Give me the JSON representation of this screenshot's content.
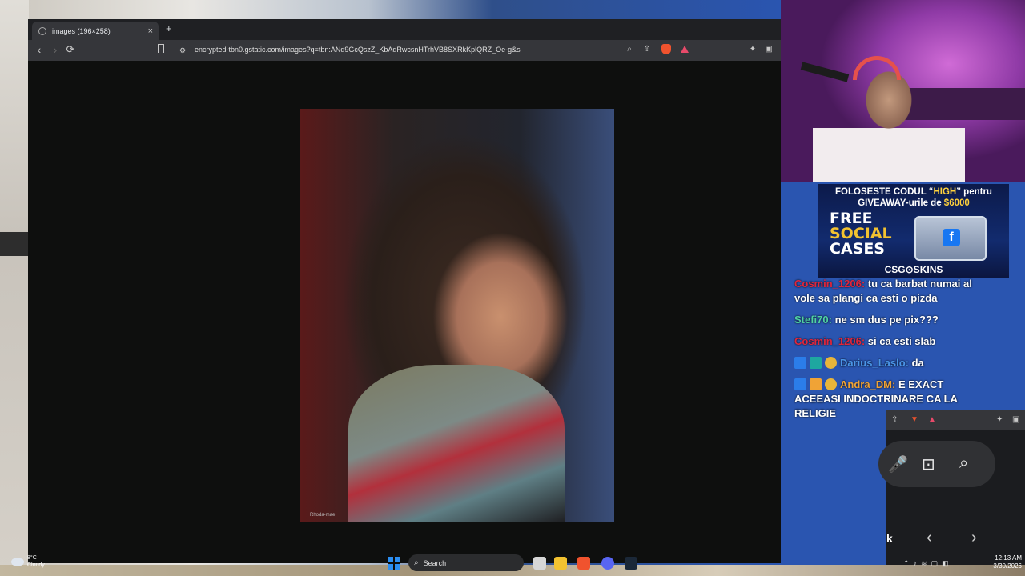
{
  "browser": {
    "tab_title": "images (196×258)",
    "tab_close": "×",
    "new_tab": "+",
    "back": "‹",
    "forward": "›",
    "reload": "⟳",
    "url": "encrypted-tbn0.gstatic.com/images?q=tbn:ANd9GcQszZ_KbAdRwcsnHTrhVB8SXRkKplQRZ_Oe-g&s",
    "image_watermark": "Rhoda-mae"
  },
  "taskbar": {
    "weather_temp": "8°C",
    "weather_desc": "Cloudy",
    "search_label": "Search",
    "time": "12:13 AM",
    "date": "3/30/2026"
  },
  "ad": {
    "line1_a": "FOLOSESTE CODUL “",
    "line1_code": "HIGH",
    "line1_b": "” pentru",
    "line2_a": "GIVEAWAY-urile de ",
    "line2_amount": "$6000",
    "promo_1": "FREE",
    "promo_2": "SOCIAL",
    "promo_3": "CASES",
    "crate_label": "f",
    "brand": "CSG⊙SKINS"
  },
  "chat": {
    "messages": [
      {
        "user": "Cosmin_1206:",
        "text": " tu ca barbat numai al",
        "color": "#e0263c"
      },
      {
        "user": "",
        "text": "vole sa plangi ca esti o pizda",
        "color": "#ffffff"
      },
      {
        "user": "Stefi70:",
        "text": " ne sm dus pe pix???",
        "color": "#4fd1a3"
      },
      {
        "user": "Cosmin_1206:",
        "text": " si ca esti slab",
        "color": "#e0263c"
      },
      {
        "user": "Darius_Laslo:",
        "text": " da",
        "color": "#4a95e8"
      },
      {
        "user": "Andra_DM:",
        "text": " E EXACT ACEEASI INDOCTRINARE CA LA RELIGIE",
        "color": "#f0a336"
      }
    ]
  },
  "window2": {
    "partial_text": "k",
    "prev": "‹",
    "next": "›"
  },
  "colors": {
    "browser_bg": "#0f100f",
    "chrome_toolbar": "#35363a",
    "brave_orange": "#f0532e",
    "ad_gold": "#ffd23c"
  }
}
